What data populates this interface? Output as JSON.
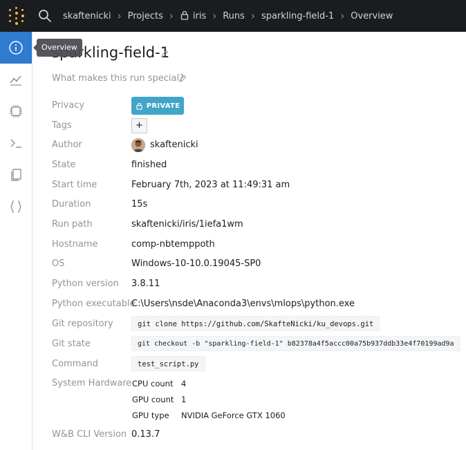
{
  "breadcrumb": {
    "user": "skaftenicki",
    "projects": "Projects",
    "project": "iris",
    "runs": "Runs",
    "run": "sparkling-field-1",
    "page": "Overview"
  },
  "sidebar": {
    "items": [
      {
        "name": "overview",
        "icon": "info-icon"
      },
      {
        "name": "charts",
        "icon": "line-chart-icon"
      },
      {
        "name": "system",
        "icon": "chip-icon"
      },
      {
        "name": "logs",
        "icon": "terminal-icon"
      },
      {
        "name": "files",
        "icon": "files-icon"
      },
      {
        "name": "artifacts",
        "icon": "braces-icon"
      }
    ],
    "tooltip": "Overview"
  },
  "run": {
    "title": "sparkling-field-1",
    "description_placeholder": "What makes this run special?"
  },
  "fields": {
    "privacy": {
      "label": "Privacy",
      "value": "PRIVATE"
    },
    "tags": {
      "label": "Tags",
      "add": "+"
    },
    "author": {
      "label": "Author",
      "value": "skaftenicki"
    },
    "state": {
      "label": "State",
      "value": "finished"
    },
    "start_time": {
      "label": "Start time",
      "value": "February 7th, 2023 at 11:49:31 am"
    },
    "duration": {
      "label": "Duration",
      "value": "15s"
    },
    "run_path": {
      "label": "Run path",
      "value": "skaftenicki/iris/1iefa1wm"
    },
    "hostname": {
      "label": "Hostname",
      "value": "comp-nbtemppoth"
    },
    "os": {
      "label": "OS",
      "value": "Windows-10-10.0.19045-SP0"
    },
    "python_version": {
      "label": "Python version",
      "value": "3.8.11"
    },
    "python_executable": {
      "label": "Python executable",
      "value": "C:\\Users\\nsde\\Anaconda3\\envs\\mlops\\python.exe"
    },
    "git_repository": {
      "label": "Git repository",
      "value": "git clone https://github.com/SkafteNicki/ku_devops.git"
    },
    "git_state": {
      "label": "Git state",
      "value": "git checkout -b \"sparkling-field-1\" b82378a4f5accc00a75b937ddb33e4f70199ad9a"
    },
    "command": {
      "label": "Command",
      "value": "test_script.py"
    },
    "system_hardware": {
      "label": "System Hardware",
      "cpu_label": "CPU count",
      "cpu_value": "4",
      "gpu_count_label": "GPU count",
      "gpu_count_value": "1",
      "gpu_type_label": "GPU type",
      "gpu_type_value": "NVIDIA GeForce GTX 1060"
    },
    "cli_version": {
      "label": "W&B CLI Version",
      "value": "0.13.7"
    }
  },
  "colors": {
    "topbar": "#1a1c1f",
    "accent": "#2e7bcf",
    "private_button": "#41a5c9",
    "logo": "#fcbc32"
  }
}
